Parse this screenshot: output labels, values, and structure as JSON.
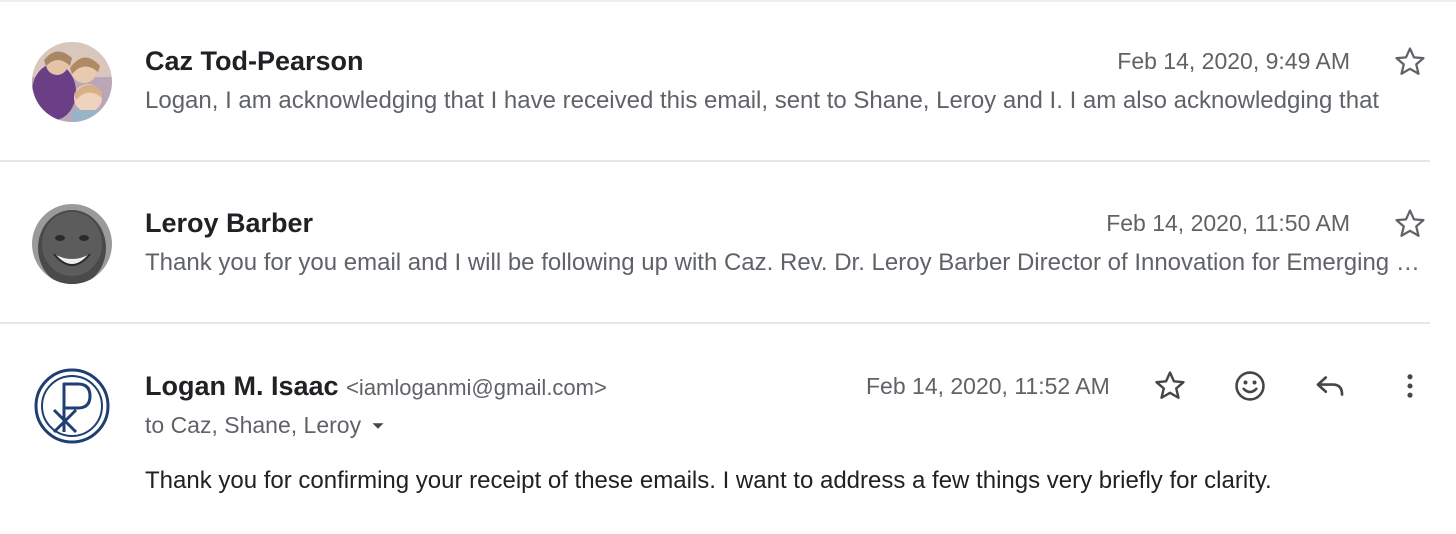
{
  "messages": [
    {
      "sender": "Caz Tod-Pearson",
      "date": "Feb 14, 2020, 9:49 AM",
      "snippet": "Logan, I am acknowledging that I have received this email, sent to Shane, Leroy and I. I am also acknowledging that"
    },
    {
      "sender": "Leroy Barber",
      "date": "Feb 14, 2020, 11:50 AM",
      "snippet": "Thank you for you email and I will be following up with Caz. Rev. Dr. Leroy Barber Director of Innovation for Emerging Leaders"
    }
  ],
  "open_message": {
    "sender": "Logan M. Isaac",
    "email": "<iamloganmi@gmail.com>",
    "date": "Feb 14, 2020, 11:52 AM",
    "recipients": "to Caz, Shane, Leroy",
    "body": "Thank you for confirming your receipt of these emails. I want to address a few things very briefly for clarity."
  },
  "icons": {
    "star": "star-icon",
    "emoji": "emoji-icon",
    "reply": "reply-icon",
    "more": "more-vert-icon",
    "dropdown": "caret-down-icon"
  },
  "colors": {
    "logo_blue": "#1f3f73",
    "text_primary": "#202124",
    "text_secondary": "#5f6368"
  }
}
